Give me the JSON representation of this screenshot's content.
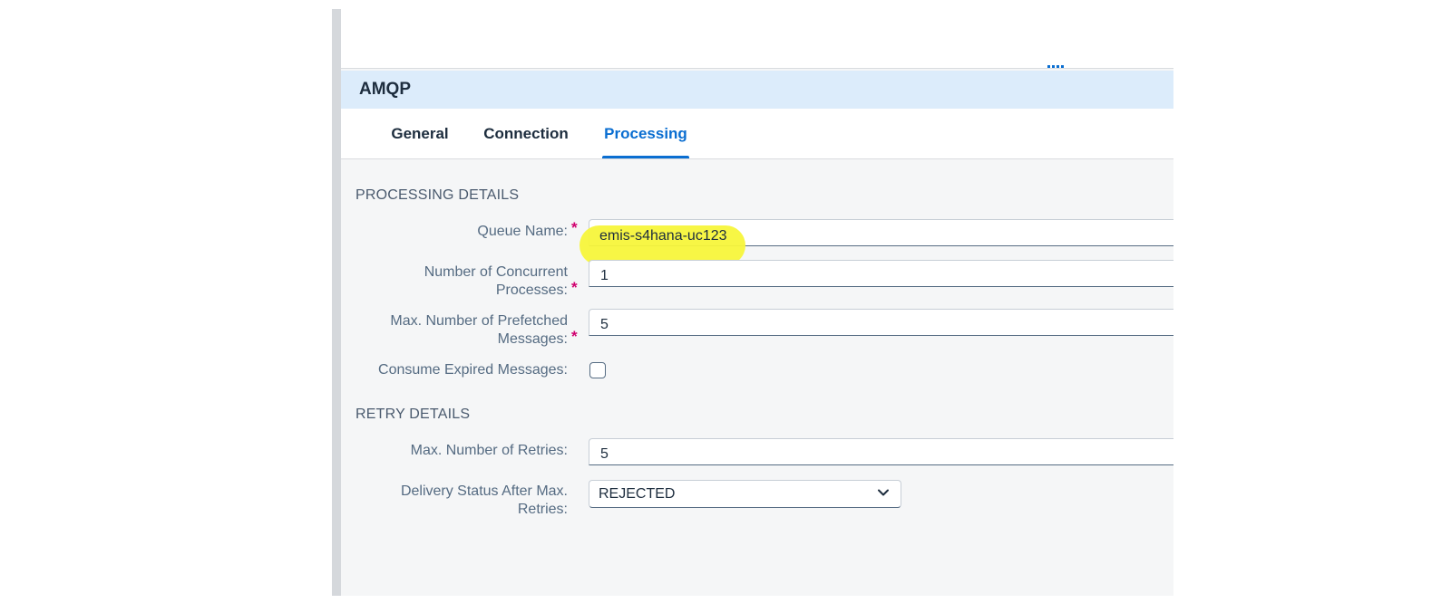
{
  "header": {
    "title": "AMQP"
  },
  "tabs": [
    {
      "label": "General"
    },
    {
      "label": "Connection"
    },
    {
      "label": "Processing"
    }
  ],
  "processing": {
    "section_title": "PROCESSING DETAILS",
    "queue_name_label": "Queue Name:",
    "queue_name_value": "emis-s4hana-uc123",
    "concurrent_label_1": "Number of Concurrent",
    "concurrent_label_2": "Processes:",
    "concurrent_value": "1",
    "prefetch_label_1": "Max. Number of Prefetched",
    "prefetch_label_2": "Messages:",
    "prefetch_value": "5",
    "consume_expired_label": "Consume Expired Messages:",
    "consume_expired_checked": false
  },
  "retry": {
    "section_title": "RETRY DETAILS",
    "max_retries_label": "Max. Number of Retries:",
    "max_retries_value": "5",
    "delivery_status_label_1": "Delivery Status After Max.",
    "delivery_status_label_2": "Retries:",
    "delivery_status_value": "REJECTED"
  },
  "required_marker": "*",
  "colors": {
    "accent": "#0a6ed1",
    "header_bg": "#dcecfb",
    "required": "#d0006f",
    "highlight": "#f7f53b"
  },
  "icons": {
    "grip": "drag-handle-icon",
    "dropdown": "chevron-down-icon"
  }
}
